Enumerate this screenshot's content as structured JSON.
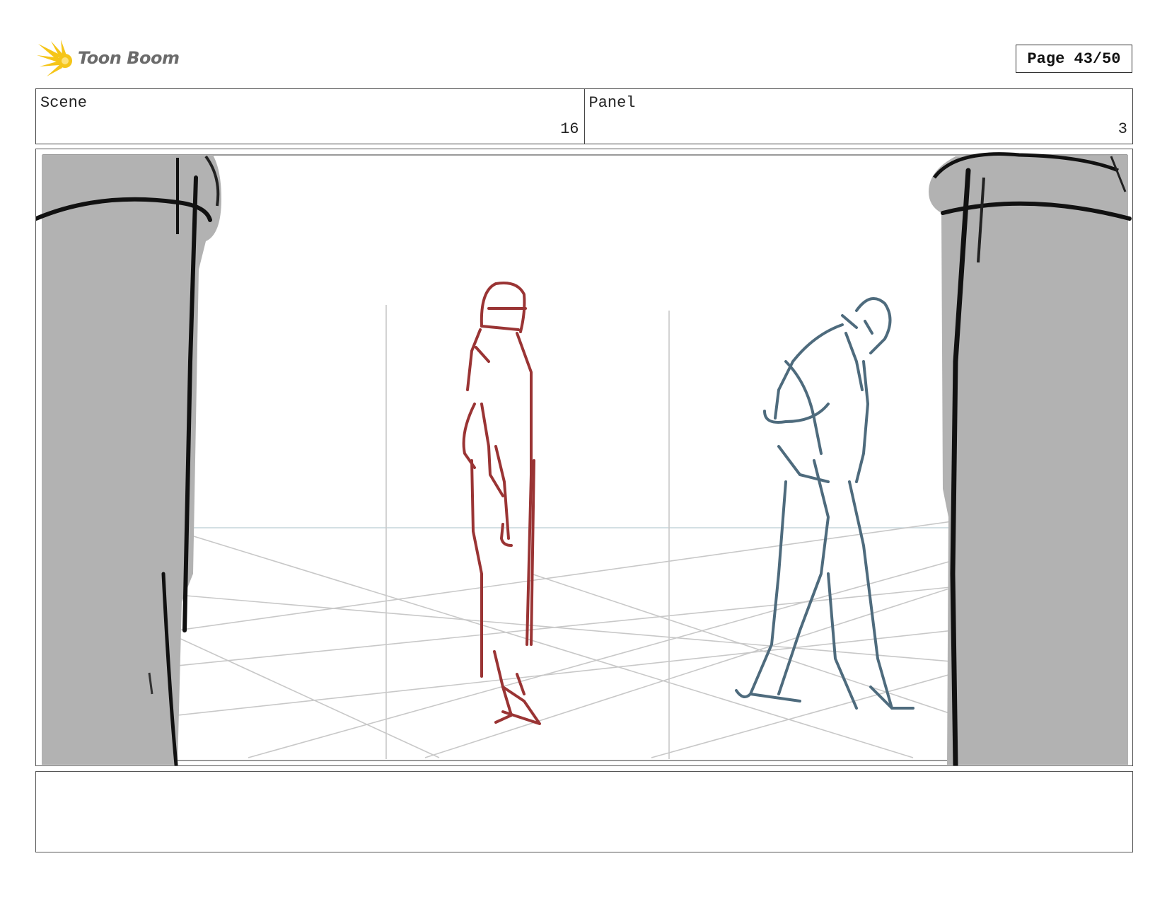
{
  "header": {
    "logo_text": "Toon Boom",
    "page_indicator": "Page 43/50"
  },
  "info": {
    "scene_label": "Scene",
    "scene_value": "16",
    "panel_label": "Panel",
    "panel_value": "3"
  },
  "panel_art": {
    "figure_left_color": "#9a3434",
    "figure_right_color": "#4e6b7d",
    "pillar_color": "#b2b2b2",
    "grid_color": "#c8c8c8"
  },
  "notes": {
    "text": ""
  }
}
